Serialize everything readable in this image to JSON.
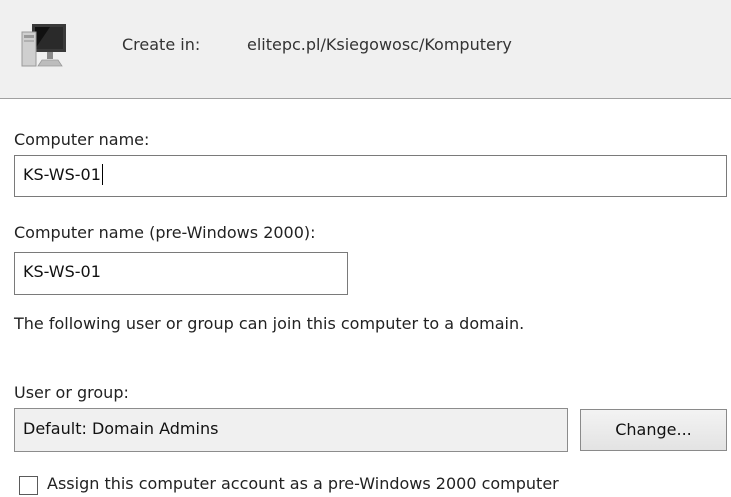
{
  "header": {
    "icon": "computer-icon",
    "create_in_label": "Create in:",
    "create_in_path": "elitepc.pl/Ksiegowosc/Komputery"
  },
  "form": {
    "computer_name_label": "Computer name:",
    "computer_name_value": "KS-WS-01",
    "pre2000_label": "Computer name (pre-Windows 2000):",
    "pre2000_value": "KS-WS-01",
    "join_note": "The following user or group can join this computer to a domain.",
    "user_group_label": "User or group:",
    "user_group_value": "Default: Domain Admins",
    "change_button": "Change...",
    "assign_checkbox_label": "Assign this computer account as a pre-Windows 2000 computer",
    "assign_checkbox_checked": false
  }
}
